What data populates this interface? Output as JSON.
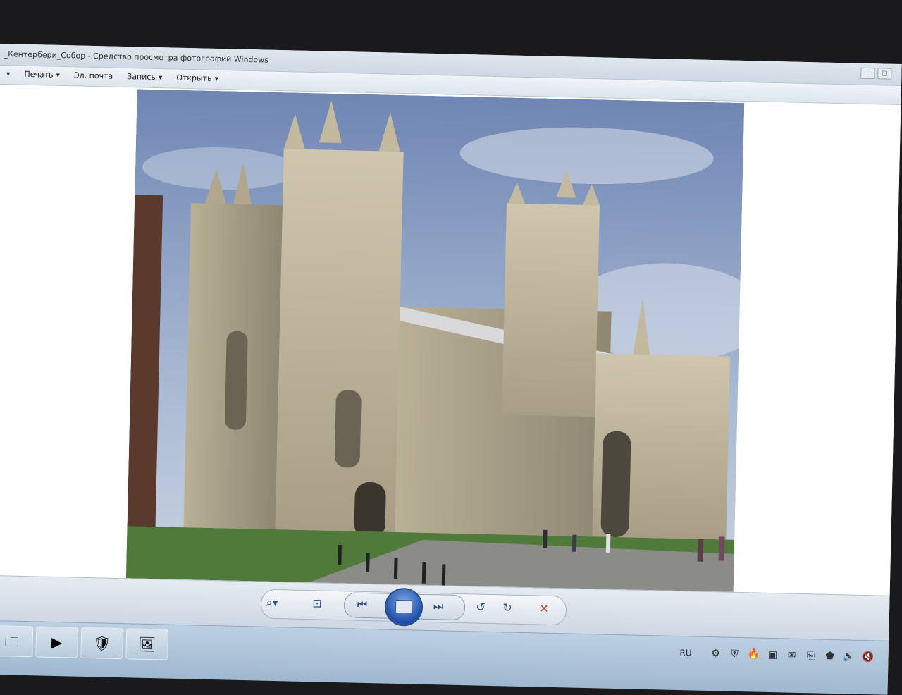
{
  "window": {
    "title": "_Кентербери_Собор - Средство просмотра фотографий Windows",
    "controls": [
      "–",
      "▢"
    ]
  },
  "menu": {
    "items": [
      {
        "label": "Печать"
      },
      {
        "label": "Эл. почта"
      },
      {
        "label": "Запись"
      },
      {
        "label": "Открыть"
      }
    ]
  },
  "viewer": {
    "image_subject": "canterbury-cathedral-photo"
  },
  "controls": {
    "zoom": "⌕▾",
    "fit": "⊡",
    "prev": "⏮",
    "next": "⏭",
    "rotate_ccw": "↺",
    "rotate_cw": "↻",
    "delete": "✕"
  },
  "taskbar": {
    "apps": [
      "🗀",
      "▶",
      "🛡",
      "🖼"
    ],
    "language": "RU",
    "tray_icons": [
      "⚙",
      "⛨",
      "🔥",
      "▣",
      "✉",
      "⎘",
      "⬟",
      "🔊",
      "🔇"
    ]
  },
  "colors": {
    "accent": "#2a4f8a",
    "delete": "#c0392b"
  }
}
